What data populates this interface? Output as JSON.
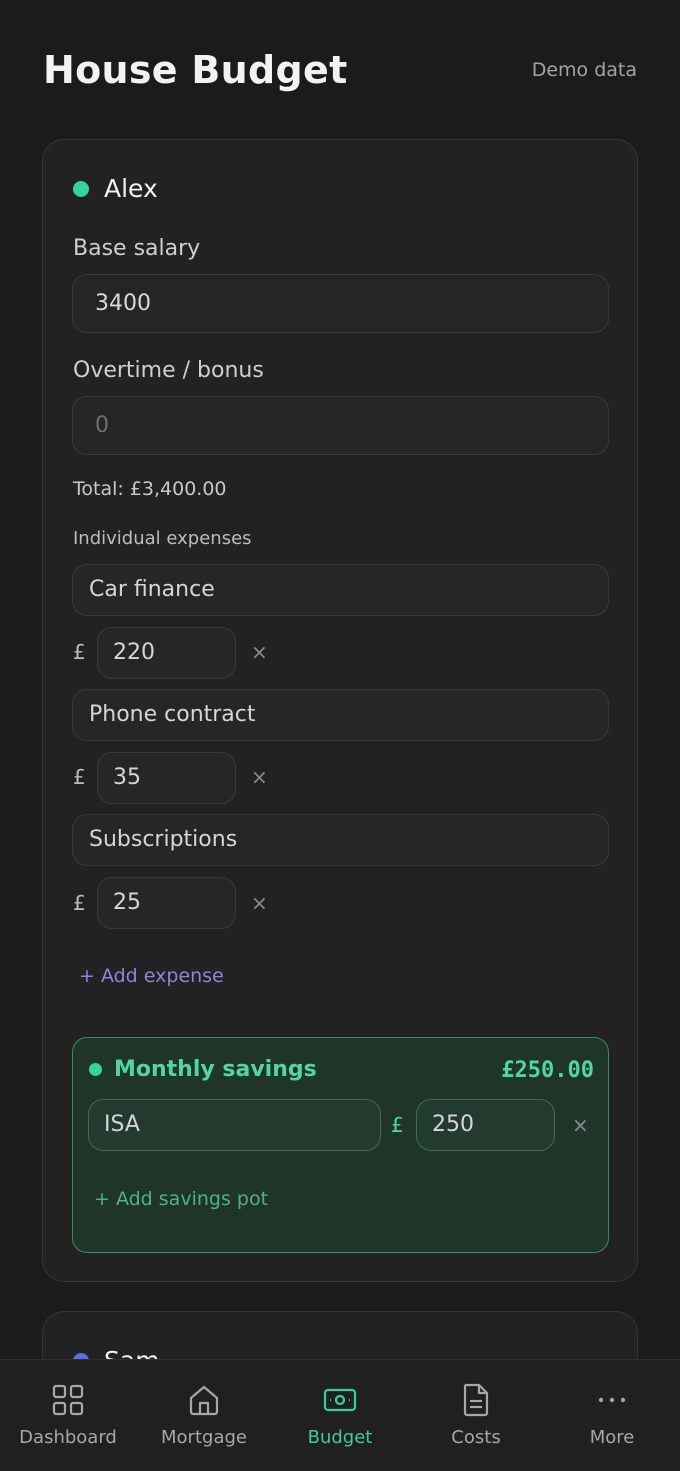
{
  "header": {
    "title": "House Budget",
    "demo_link": "Demo data"
  },
  "people": [
    {
      "name": "Alex",
      "color": "#34d399",
      "base_salary_label": "Base salary",
      "base_salary_value": "3400",
      "overtime_label": "Overtime / bonus",
      "overtime_placeholder": "0",
      "total_text": "Total: £3,400.00",
      "expenses_label": "Individual expenses",
      "expenses": [
        {
          "name": "Car finance",
          "currency": "£",
          "amount": "220",
          "remove": "×"
        },
        {
          "name": "Phone contract",
          "currency": "£",
          "amount": "35",
          "remove": "×"
        },
        {
          "name": "Subscriptions",
          "currency": "£",
          "amount": "25",
          "remove": "×"
        }
      ],
      "add_expense_label": "+ Add expense",
      "savings": {
        "title": "Monthly savings",
        "total": "£250.00",
        "pots": [
          {
            "name": "ISA",
            "currency": "£",
            "amount": "250",
            "remove": "×"
          }
        ],
        "add_pot_label": "+ Add savings pot"
      }
    },
    {
      "name": "Sam",
      "color": "#6366f1"
    }
  ],
  "nav": {
    "items": [
      {
        "label": "Dashboard",
        "icon": "grid-icon"
      },
      {
        "label": "Mortgage",
        "icon": "home-icon"
      },
      {
        "label": "Budget",
        "icon": "banknote-icon",
        "active": true
      },
      {
        "label": "Costs",
        "icon": "document-icon"
      },
      {
        "label": "More",
        "icon": "ellipsis-icon"
      }
    ]
  },
  "colors": {
    "accent": "#3ecf95",
    "link": "#8b86d6",
    "background": "#1b1b1b"
  }
}
